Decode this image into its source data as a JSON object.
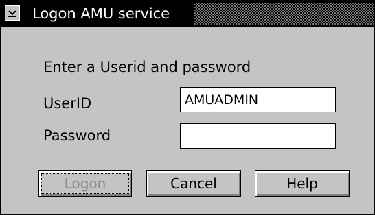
{
  "window": {
    "title": "Logon AMU service",
    "system_menu_icon": "down-arrow-icon"
  },
  "form": {
    "prompt": "Enter a Userid and password",
    "userid_label": "UserID",
    "userid_value": "AMUADMIN",
    "password_label": "Password",
    "password_value": ""
  },
  "buttons": {
    "logon": "Logon",
    "cancel": "Cancel",
    "help": "Help"
  },
  "colors": {
    "titlebar": "#000000",
    "dialog_background": "#c4c4c4",
    "disabled_text": "#8a8a8a"
  }
}
